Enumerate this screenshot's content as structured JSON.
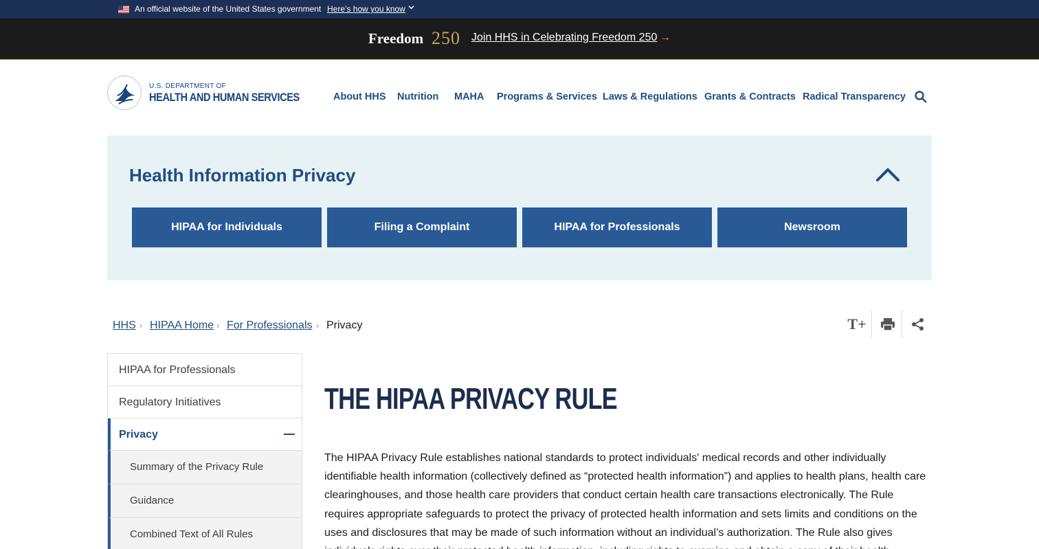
{
  "gov_banner": {
    "text": "An official website of the United States government",
    "link": "Here’s how you know",
    "chevron": "⌄"
  },
  "freedom_bar": {
    "logo_word": "Freedom",
    "logo_number": "250",
    "link": "Join HHS in Celebrating Freedom 250",
    "arrow": "→"
  },
  "header": {
    "dept_line": "U.S. DEPARTMENT OF",
    "dept_name": "HEALTH AND HUMAN SERVICES",
    "nav": [
      {
        "label": "About HHS"
      },
      {
        "label": "Nutrition"
      },
      {
        "label": "MAHA"
      },
      {
        "label": "Programs & Services"
      },
      {
        "label": "Laws & Regulations"
      },
      {
        "label": "Grants & Contracts"
      },
      {
        "label": "Radical Transparency"
      }
    ],
    "search_icon": "search-icon"
  },
  "hero": {
    "title": "Health Information Privacy",
    "buttons": [
      {
        "label": "HIPAA for Individuals"
      },
      {
        "label": "Filing a Complaint"
      },
      {
        "label": "HIPAA for Professionals"
      },
      {
        "label": "Newsroom"
      }
    ]
  },
  "breadcrumb": {
    "items": [
      {
        "label": "HHS"
      },
      {
        "label": "HIPAA Home"
      },
      {
        "label": "For Professionals"
      }
    ],
    "current": "Privacy",
    "separator": "›"
  },
  "tools": {
    "text_size": "T+",
    "print_icon": "printer-icon",
    "share_icon": "share-icon"
  },
  "sidebar": {
    "items": [
      {
        "label": "HIPAA for Professionals"
      },
      {
        "label": "Regulatory Initiatives"
      },
      {
        "label": "Privacy"
      }
    ],
    "sub_items": [
      {
        "label": "Summary of the Privacy Rule"
      },
      {
        "label": "Guidance"
      },
      {
        "label": "Combined Text of All Rules"
      }
    ]
  },
  "main": {
    "title": "THE HIPAA PRIVACY RULE",
    "paragraph": "The HIPAA Privacy Rule establishes national standards to protect individuals' medical records and other individually identifiable health information (collectively defined as “protected health information”) and applies to health plans, health care clearinghouses, and those health care providers that conduct certain health care transactions electronically. The Rule requires appropriate safeguards to protect the privacy of protected health information and sets limits and conditions on the uses and disclosures that may be made of such information without an individual’s authorization. The Rule also gives individuals rights over their protected health information, including rights to examine and obtain a copy of their health"
  },
  "colors": {
    "gov_banner_bg": "#1c2f55",
    "freedom_bg": "#1b1b1b",
    "primary_blue": "#1f4d83",
    "button_blue": "#2a5a96",
    "hero_bg": "#e7f2f5"
  }
}
